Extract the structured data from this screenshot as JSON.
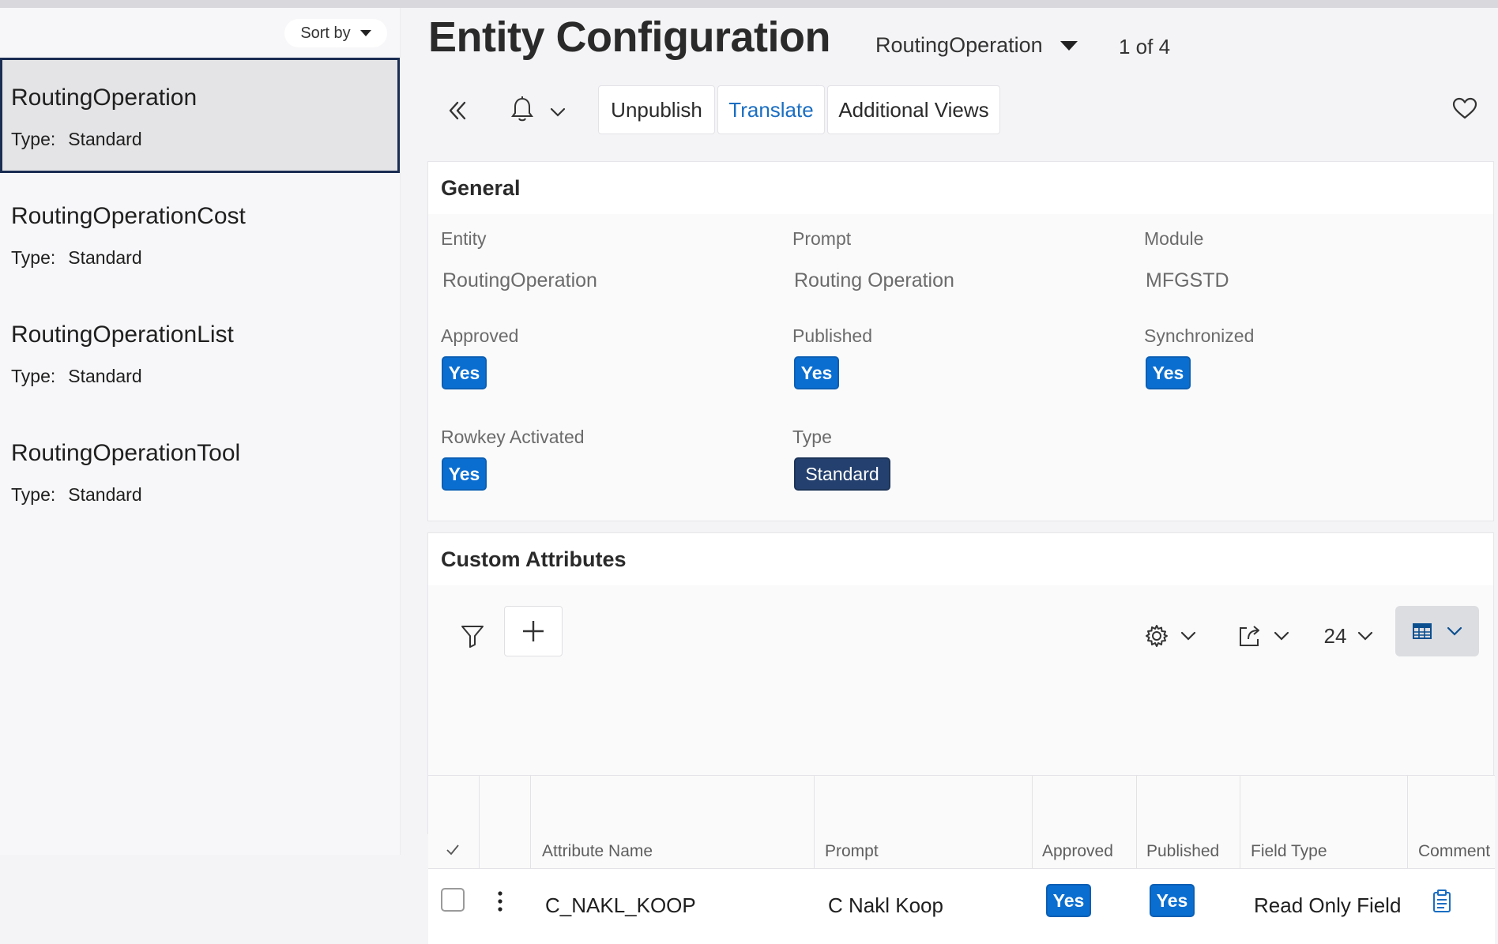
{
  "sidebar": {
    "sort_label": "Sort by",
    "type_label": "Type:",
    "items": [
      {
        "name": "RoutingOperation",
        "type": "Standard"
      },
      {
        "name": "RoutingOperationCost",
        "type": "Standard"
      },
      {
        "name": "RoutingOperationList",
        "type": "Standard"
      },
      {
        "name": "RoutingOperationTool",
        "type": "Standard"
      }
    ]
  },
  "header": {
    "title": "Entity Configuration",
    "entity_selector": "RoutingOperation",
    "pager": "1 of 4"
  },
  "toolbar": {
    "icons": [
      "double-chevron-left-icon",
      "bell-icon",
      "chevron-down-icon",
      "heart-icon"
    ],
    "unpublish_label": "Unpublish",
    "translate_label": "Translate",
    "additional_views_label": "Additional Views"
  },
  "general": {
    "title": "General",
    "entity_label": "Entity",
    "entity_value": "RoutingOperation",
    "prompt_label": "Prompt",
    "prompt_value": "Routing Operation",
    "module_label": "Module",
    "module_value": "MFGSTD",
    "approved_label": "Approved",
    "approved_value": "Yes",
    "published_label": "Published",
    "published_value": "Yes",
    "synchronized_label": "Synchronized",
    "synchronized_value": "Yes",
    "rowkey_label": "Rowkey Activated",
    "rowkey_value": "Yes",
    "type_label": "Type",
    "type_value": "Standard"
  },
  "custom_attributes": {
    "title": "Custom Attributes",
    "page_size": "24",
    "toolbar_icons": [
      "filter-icon",
      "plus-icon",
      "gear-icon",
      "export-icon",
      "table-view-icon"
    ],
    "columns": [
      "Attribute Name",
      "Prompt",
      "Approved",
      "Published",
      "Field Type",
      "Comment"
    ],
    "rows": [
      {
        "attribute_name": "C_NAKL_KOOP",
        "prompt": "C Nakl Koop",
        "approved": "Yes",
        "published": "Yes",
        "field_type": "Read Only Field",
        "comment_icon": "clipboard-icon"
      }
    ]
  },
  "colors": {
    "accent": "#0a6ed1",
    "link": "#1a6ec2",
    "selected_border": "#1a2d52",
    "badge_dark": "#24406e"
  }
}
